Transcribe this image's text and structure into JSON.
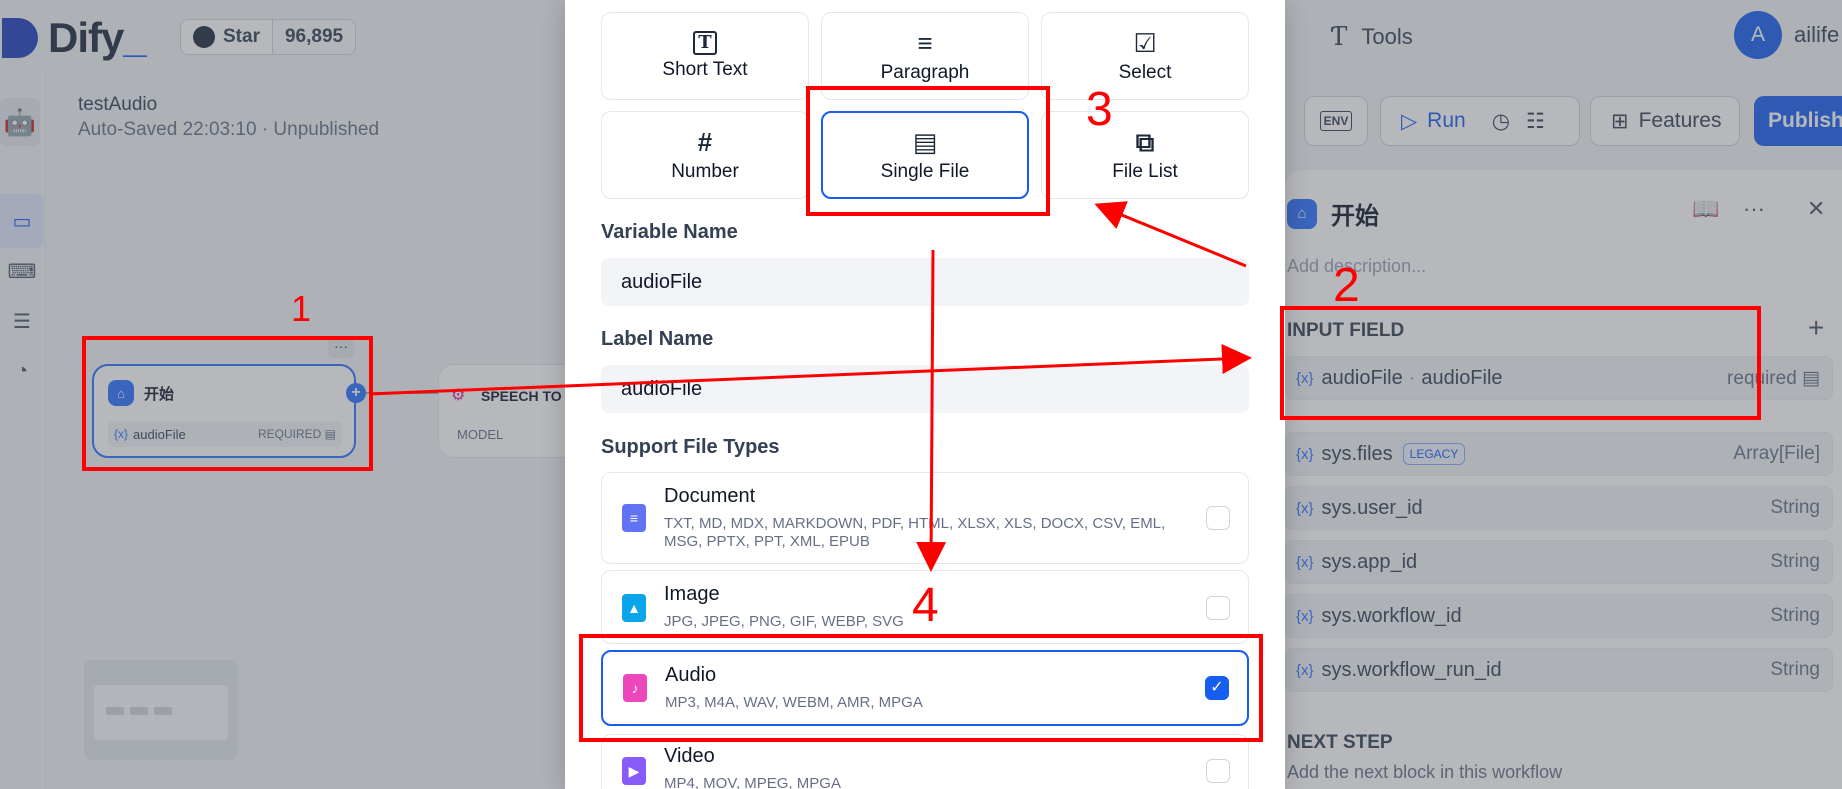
{
  "header": {
    "logo_text": "Dify",
    "logo_underscore": "_",
    "github_star_label": "Star",
    "github_star_count": "96,895",
    "tools_label": "Tools",
    "avatar_initial": "A",
    "username": "ailife"
  },
  "app": {
    "name": "testAudio",
    "status": "Auto-Saved 22:03:10 · Unpublished"
  },
  "canvas": {
    "start_node": {
      "title": "开始",
      "var_prefix": "{x}",
      "var_name": "audioFile",
      "required_label": "REQUIRED",
      "dots": "···",
      "plus": "+"
    },
    "speech_node": {
      "title": "SPEECH TO",
      "model_label": "MODEL"
    }
  },
  "toolbar": {
    "env_label": "ENV",
    "run_label": "Run",
    "features_label": "Features",
    "publish_label": "Publish"
  },
  "panel": {
    "title": "开始",
    "description_placeholder": "Add description...",
    "input_field_title": "INPUT FIELD",
    "input_fields": [
      {
        "prefix": "{x}",
        "name": "audioFile",
        "label": "audioFile",
        "required": "required"
      }
    ],
    "system_vars": [
      {
        "prefix": "{x}",
        "name": "sys.files",
        "badge": "LEGACY",
        "type": "Array[File]"
      },
      {
        "prefix": "{x}",
        "name": "sys.user_id",
        "type": "String"
      },
      {
        "prefix": "{x}",
        "name": "sys.app_id",
        "type": "String"
      },
      {
        "prefix": "{x}",
        "name": "sys.workflow_id",
        "type": "String"
      },
      {
        "prefix": "{x}",
        "name": "sys.workflow_run_id",
        "type": "String"
      }
    ],
    "next_step_title": "NEXT STEP",
    "next_step_desc": "Add the next block in this workflow"
  },
  "modal": {
    "field_types": [
      {
        "icon": "text-type-icon",
        "glyph": "T",
        "label": "Short Text",
        "selected": false
      },
      {
        "icon": "paragraph-icon",
        "glyph": "≡",
        "label": "Paragraph",
        "selected": false
      },
      {
        "icon": "select-icon",
        "glyph": "☑",
        "label": "Select",
        "selected": false
      },
      {
        "icon": "number-icon",
        "glyph": "#",
        "label": "Number",
        "selected": false
      },
      {
        "icon": "file-icon",
        "glyph": "▤",
        "label": "Single File",
        "selected": true
      },
      {
        "icon": "file-list-icon",
        "glyph": "⧉",
        "label": "File List",
        "selected": false
      }
    ],
    "variable_name_label": "Variable Name",
    "variable_name_value": "audioFile",
    "label_name_label": "Label Name",
    "label_name_value": "audioFile",
    "support_types_label": "Support File Types",
    "file_types": [
      {
        "name": "Document",
        "desc": "TXT, MD, MDX, MARKDOWN, PDF, HTML, XLSX, XLS, DOCX, CSV, EML, MSG, PPTX, PPT, XML, EPUB",
        "color": "#6172f3",
        "checked": false
      },
      {
        "name": "Image",
        "desc": "JPG, JPEG, PNG, GIF, WEBP, SVG",
        "color": "#0ba5ec",
        "checked": false
      },
      {
        "name": "Audio",
        "desc": "MP3, M4A, WAV, WEBM, AMR, MPGA",
        "color": "#ee46bc",
        "checked": true
      },
      {
        "name": "Video",
        "desc": "MP4, MOV, MPEG, MPGA",
        "color": "#875bf7",
        "checked": false
      }
    ]
  },
  "annotations": {
    "n1": "1",
    "n2": "2",
    "n3": "3",
    "n4": "4",
    "color": "#ff0000"
  }
}
